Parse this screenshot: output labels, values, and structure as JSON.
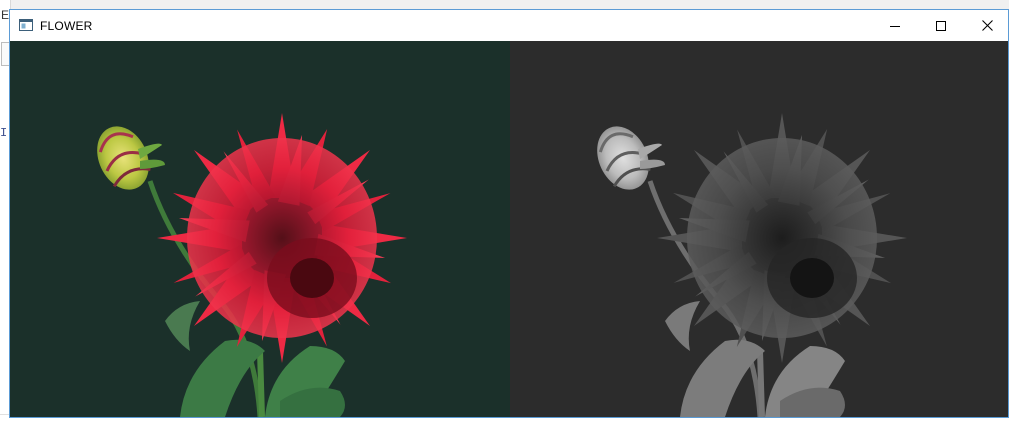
{
  "window": {
    "title": "FLOWER",
    "icon": "app-window-icon",
    "controls": {
      "minimize": "minimize-icon",
      "maximize": "maximize-icon",
      "close": "close-icon"
    }
  },
  "images": {
    "color": {
      "name": "color-flower-image",
      "background": "#1b302a",
      "petal": "#e8213a",
      "bud": "#c5cf4a",
      "leaf": "#3a6b3a"
    },
    "grayscale": {
      "name": "grayscale-flower-image",
      "background": "#2c2c2c"
    }
  },
  "background_app": {
    "visible_fragments": [
      "E",
      "I"
    ]
  }
}
